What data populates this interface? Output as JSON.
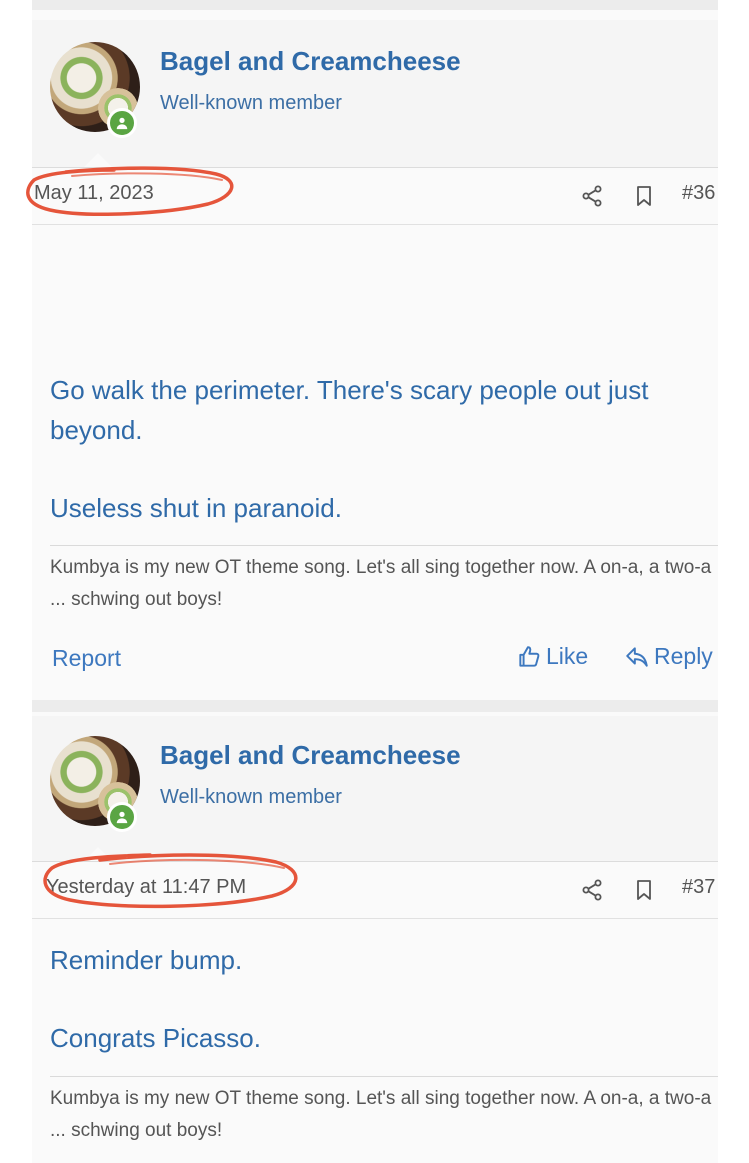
{
  "posts": [
    {
      "username": "Bagel and Creamcheese",
      "user_title": "Well-known member",
      "date": "May 11, 2023",
      "post_number": "#36",
      "message_lines": [
        "Go walk the perimeter. There's scary people out just beyond.",
        "Useless shut in paranoid."
      ],
      "signature": "Kumbya is my new OT theme song. Let's all sing together now. A on-a, a two-a ... schwing out boys!",
      "report_label": "Report",
      "like_label": "Like",
      "reply_label": "Reply"
    },
    {
      "username": "Bagel and Creamcheese",
      "user_title": "Well-known member",
      "date": "Yesterday at 11:47 PM",
      "post_number": "#37",
      "message_lines": [
        "Reminder bump.",
        "Congrats Picasso."
      ],
      "signature": "Kumbya is my new OT theme song. Let's all sing together now. A on-a, a two-a ... schwing out boys!"
    }
  ],
  "colors": {
    "link": "#2f6aa8",
    "annotation": "#e5553b",
    "online": "#5aa543"
  },
  "icons": [
    "share-icon",
    "bookmark-icon",
    "thumbs-up-icon",
    "reply-icon",
    "user-online-icon"
  ]
}
